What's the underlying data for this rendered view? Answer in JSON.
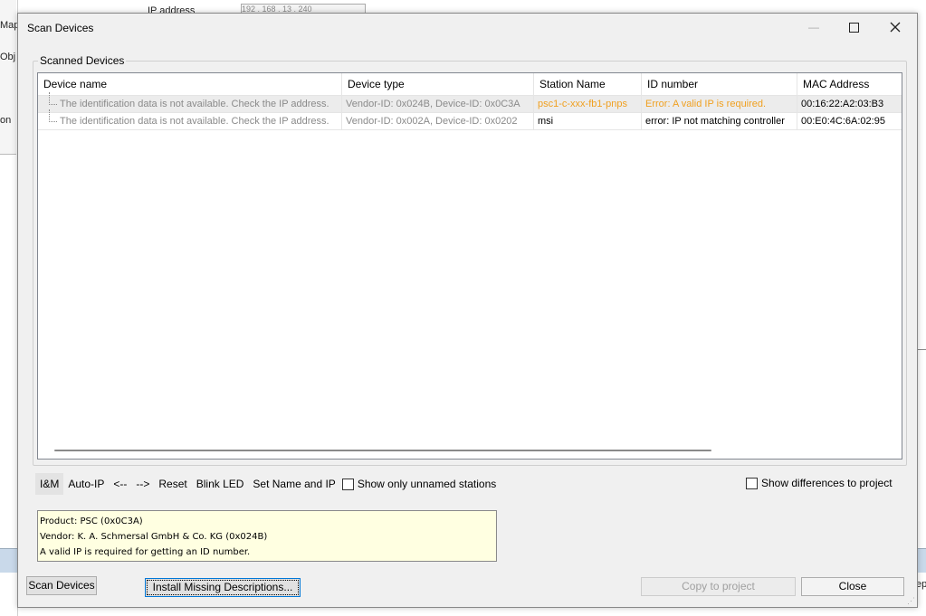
{
  "background": {
    "left_labels": [
      "Map",
      "Obj",
      "on"
    ],
    "top_label": "IP address",
    "top_value": "192 . 168 . 13 . 240",
    "right_fragment": "ep"
  },
  "dialog": {
    "title": "Scan Devices",
    "group_label": "Scanned Devices",
    "columns": [
      "Device name",
      "Device type",
      "Station Name",
      "ID number",
      "MAC Address"
    ],
    "rows": [
      {
        "device_name": "The identification data is not available. Check the IP address.",
        "device_type": "Vendor-ID: 0x024B, Device-ID: 0x0C3A",
        "station_name": "psc1-c-xxx-fb1-pnps",
        "id_number": "Error: A valid IP is required.",
        "mac": "00:16:22:A2:03:B3"
      },
      {
        "device_name": "The identification data is not available. Check the IP address.",
        "device_type": "Vendor-ID: 0x002A, Device-ID: 0x0202",
        "station_name": "msi",
        "id_number": "error: IP not matching controller",
        "mac": "00:E0:4C:6A:02:95"
      }
    ],
    "toolbar": {
      "im": "I&M",
      "auto_ip": "Auto-IP",
      "prev": "<--",
      "next": "-->",
      "reset": "Reset",
      "blink": "Blink LED",
      "set_name": "Set Name and IP",
      "show_unnamed": "Show only unnamed stations",
      "show_unnamed_checked": false
    },
    "show_differences": "Show differences to project",
    "show_differences_checked": false,
    "info": {
      "product": "Product: PSC (0x0C3A)",
      "vendor": "Vendor: K. A. Schmersal GmbH & Co. KG (0x024B)",
      "message": "A valid IP is required for getting an ID number."
    },
    "buttons": {
      "scan": "Scan Devices",
      "install": "Install Missing Descriptions...",
      "copy": "Copy to project",
      "close": "Close"
    },
    "colors": {
      "error_text": "#f0a020",
      "disabled_text": "#8a8a8a",
      "info_bg": "#ffffe1"
    }
  }
}
